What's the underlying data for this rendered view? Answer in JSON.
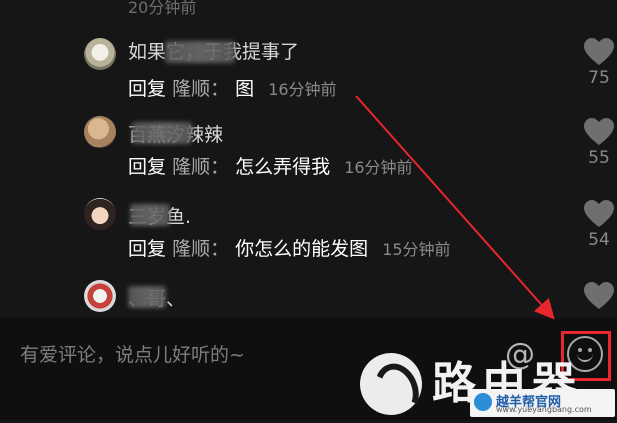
{
  "feed": {
    "top_time": "20分钟前",
    "comments": [
      {
        "username": "如果它，于我提事了",
        "reply_keyword": "回复",
        "reply_name": "隆顺：",
        "message": "图",
        "time": "16分钟前",
        "likes": "75"
      },
      {
        "username": "百燕汐辣辣",
        "reply_keyword": "回复",
        "reply_name": "隆顺：",
        "message": "怎么弄得我",
        "time": "16分钟前",
        "likes": "55"
      },
      {
        "username": "三岁鱼.",
        "reply_keyword": "回复",
        "reply_name": "隆顺：",
        "message": "你怎么的能发图",
        "time": "15分钟前",
        "likes": "54"
      },
      {
        "username": "、哥、",
        "likes": ""
      }
    ]
  },
  "input": {
    "placeholder": "有爱评论，说点儿好听的~",
    "at_symbol": "@"
  },
  "icons": {
    "at": "at-icon",
    "emoji": "emoji-icon",
    "heart": "heart-icon"
  },
  "annotation": {
    "color": "#e8262e"
  },
  "watermark": {
    "text": "路由器",
    "badge_cn": "越羊帮官网",
    "badge_url": "www.yueyangbang.com"
  }
}
